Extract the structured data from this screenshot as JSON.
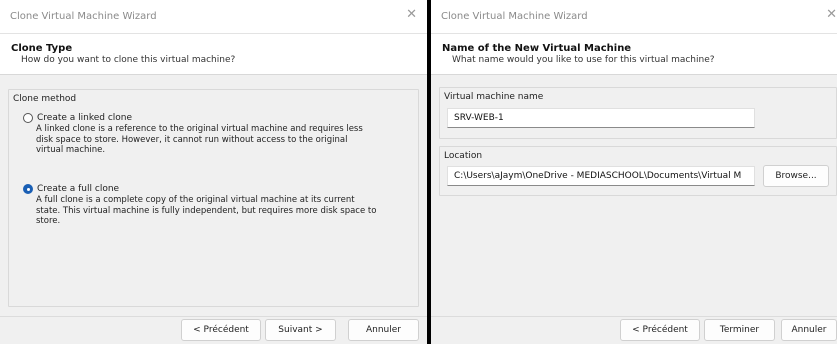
{
  "left_dialog": {
    "window_title": "Clone Virtual Machine Wizard",
    "header_title": "Clone Type",
    "header_subtitle": "How do you want to clone this virtual machine?",
    "group_label": "Clone method",
    "options": [
      {
        "label": "Create a linked clone",
        "checked": false,
        "desc_lines": [
          "A linked clone is a reference to the original virtual machine and requires less",
          "disk space to store. However, it cannot run without access to the original",
          "virtual machine."
        ]
      },
      {
        "label": "Create a full clone",
        "checked": true,
        "desc_lines": [
          "A full clone is a complete copy of the original virtual machine at its current",
          "state. This virtual machine is fully independent, but requires more disk space to",
          "store."
        ]
      }
    ],
    "buttons": {
      "back": "< Précédent",
      "next": "Suivant >",
      "cancel": "Annuler"
    }
  },
  "right_dialog": {
    "window_title": "Clone Virtual Machine Wizard",
    "header_title": "Name of the New Virtual Machine",
    "header_subtitle": "What name would you like to use for this virtual machine?",
    "name_label": "Virtual machine name",
    "name_value": "SRV-WEB-1",
    "location_label": "Location",
    "location_value": "C:\\Users\\aJaym\\OneDrive - MEDIASCHOOL\\Documents\\Virtual M",
    "browse": "Browse...",
    "buttons": {
      "back": "< Précédent",
      "finish": "Terminer",
      "cancel": "Annuler"
    }
  },
  "colors": {
    "dialog_bg": "#f0f0f0",
    "divider": "#000000",
    "radio_selected": "#1a5fb4"
  }
}
